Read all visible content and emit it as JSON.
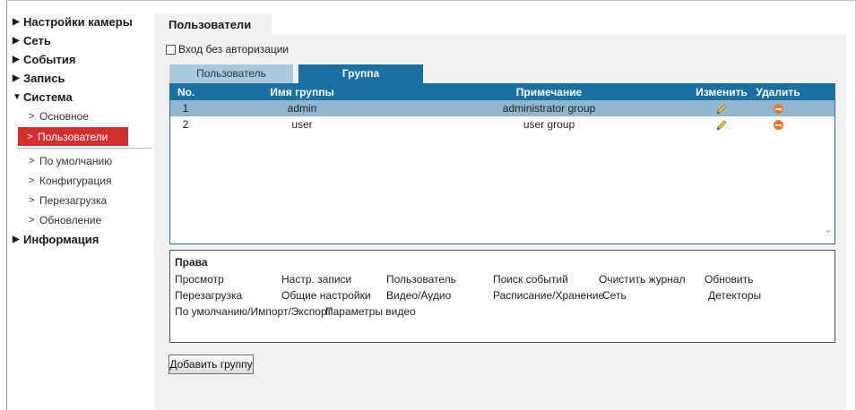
{
  "sidebar": {
    "camera_settings": "Настройки камеры",
    "network": "Сеть",
    "events": "События",
    "record": "Запись",
    "system": "Система",
    "system_items": [
      "Основное",
      "Пользователи",
      "По умолчанию",
      "Конфигурация",
      "Перезагрузка",
      "Обновление"
    ],
    "info": "Информация"
  },
  "page": {
    "tab_title": "Пользователи",
    "no_auth_label": "Вход без авторизации",
    "no_auth_checked": false
  },
  "tabs": {
    "user": "Пользователь",
    "group": "Группа"
  },
  "table": {
    "headers": {
      "no": "No.",
      "name": "Имя группы",
      "note": "Примечание",
      "edit": "Изменить",
      "delete": "Удалить"
    },
    "rows": [
      {
        "no": "1",
        "name": "admin",
        "note": "administrator group",
        "selected": true
      },
      {
        "no": "2",
        "name": "user",
        "note": "user group",
        "selected": false
      }
    ]
  },
  "rights": {
    "title": "Права",
    "items": [
      "Просмотр",
      "Настр. записи",
      "Пользователь",
      "Поиск событий",
      "Очистить журнал",
      "Обновить",
      "Перезагрузка",
      "Общие настройки",
      "Видео/Аудио",
      "Расписание/Хранение",
      "Сеть",
      "Детекторы",
      "По умолчанию/Импорт/Экспорт",
      "Параметры видео"
    ]
  },
  "buttons": {
    "add_group": "Добавить группу"
  },
  "colors": {
    "accent": "#1a6fa3",
    "active_nav": "#d32f2f",
    "selected_row": "#8fb7cf",
    "delete": "#f07a24"
  }
}
